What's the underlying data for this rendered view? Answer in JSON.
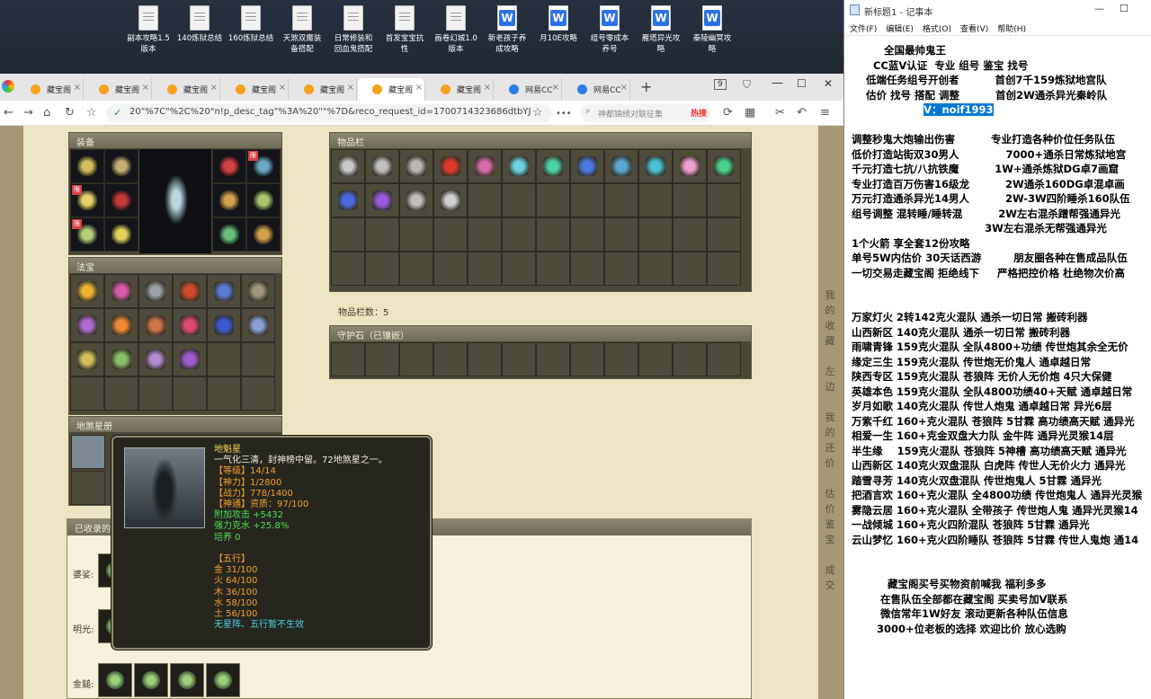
{
  "desktop_icons": [
    {
      "label": "副本攻略1.5\n版本",
      "type": "doc"
    },
    {
      "label": "140炼狱总结",
      "type": "doc"
    },
    {
      "label": "160炼狱总结",
      "type": "doc"
    },
    {
      "label": "天煞双魔装\n备搭配",
      "type": "doc"
    },
    {
      "label": "日常修装和\n回血鬼搭配",
      "type": "doc"
    },
    {
      "label": "首发宝宝抗\n性",
      "type": "doc"
    },
    {
      "label": "画卷幻城1.0\n版本",
      "type": "doc"
    },
    {
      "label": "新老孩子养\n成攻略",
      "type": "wps"
    },
    {
      "label": "月10E攻略",
      "type": "wps"
    },
    {
      "label": "组号零成本\n养号",
      "type": "wps"
    },
    {
      "label": "雁塔异光攻\n略",
      "type": "wps"
    },
    {
      "label": "秦陵幽冥攻\n略",
      "type": "wps"
    }
  ],
  "browser": {
    "tabs": [
      {
        "label": "藏宝阁",
        "fav": "orange"
      },
      {
        "label": "藏宝阁",
        "fav": "orange"
      },
      {
        "label": "藏宝阁",
        "fav": "orange"
      },
      {
        "label": "藏宝阁",
        "fav": "orange"
      },
      {
        "label": "藏宝阁",
        "fav": "orange"
      },
      {
        "label": "藏宝阁",
        "fav": "orange",
        "active": true
      },
      {
        "label": "藏宝阁",
        "fav": "orange"
      },
      {
        "label": "网易CC",
        "fav": "blue"
      },
      {
        "label": "网易CC",
        "fav": "blue"
      }
    ],
    "tab_count": "9",
    "url": "20\"%7C\"%2C%20\"n!p_desc_tag\"%3A%20\"\"%7D&reco_request_id=1700714323686dtbYJ",
    "search_placeholder": "神都锦绣对联征集",
    "search_hot": "热搜"
  },
  "game": {
    "equip_title": "装备",
    "fabao_title": "法宝",
    "inventory_title": "物品栏",
    "inventory_count": "物品栏数：5",
    "guard_title": "守护石（已镶嵌）",
    "dizhao_title": "地煞星册",
    "collected_title": "已收录的",
    "collect_rows": [
      {
        "label": "婆娑:"
      },
      {
        "label": "明光:"
      },
      {
        "label": "金鎚:"
      }
    ],
    "side_nav": [
      "我",
      "的",
      "收",
      "藏",
      "",
      "左",
      "边",
      "",
      "我",
      "的",
      "还",
      "价",
      "",
      "估",
      "价",
      "鉴",
      "宝",
      "",
      "成",
      "交"
    ],
    "equip_badge": "限",
    "colors": {
      "equip": [
        "#d2c05a",
        "#c4b070",
        "#e5d36a",
        "#c43b35",
        "#b3cf7a",
        "#e3d45a",
        "#d24242",
        "#6aa8c4",
        "#d2a44e",
        "#a8c86a",
        "#6ac07a",
        "#d0a04a"
      ],
      "fabao": [
        "#f0b432",
        "#d85aa8",
        "#9aa0a8",
        "#d24a2a",
        "#5a7ad8",
        "#a09878",
        "#b06ad2",
        "#f08a32",
        "#d2744a",
        "#e04a6a",
        "#3a5ad2",
        "#8aa0d2",
        "#d2c05a",
        "#8ac06a",
        "#b48ad2",
        "#a05ad2"
      ],
      "inventory": [
        "#c8c8c8",
        "#c0c0c0",
        "#b8b8b8",
        "#e03a2a",
        "#d86aa8",
        "#6ad2e0",
        "#4ad2a8",
        "#4a7ae0",
        "#5aa8d2",
        "#4ac0d2",
        "#f0a0d0",
        "#4ad28a",
        "#4a6ae0",
        "#9a5ae0",
        "#c0c0c0",
        "#d0d0d0"
      ]
    }
  },
  "tooltip": {
    "name": "地魁星",
    "desc": "一气化三清，封神榜中留。72地煞星之一。",
    "level": "【等级】14/14",
    "shenli": "【神力】1/2800",
    "zhanli": "【战力】778/1400",
    "shentong": "【神通】资质：97/100",
    "attack": "附加攻击 +5432",
    "keshui": "强力克水 +25.8%",
    "peiyang": "培养 0",
    "wuxing_title": "【五行】",
    "wuxing": [
      "金 31/100",
      "火 64/100",
      "木 36/100",
      "水 58/100",
      "土 56/100"
    ],
    "note": "无星阵、五行暂不生效"
  },
  "notepad": {
    "title": "新标题1 - 记事本",
    "menu": [
      "文件(F)",
      "编辑(E)",
      "格式(O)",
      "查看(V)",
      "帮助(H)"
    ],
    "lines": [
      "         全国最帅鬼王",
      "      CC蓝V认证  专业 组号 鉴宝 找号",
      "    低端任务组号开创者          首创7千159炼狱地宫队",
      "    估价 找号 搭配 调整          首创2W通杀异光秦岭队",
      "                    V：noif1993",
      "",
      "调整秒鬼大炮输出伤害          专业打造各种价位任务队伍",
      "低价打造站街双30男人             7000+通杀日常炼狱地宫",
      "千元打造七抗/八抗铁魔          1W+通杀炼狱DG卓7画窟",
      "专业打造百万伤害16级龙          2W通杀160DG卓混卓画",
      "万元打造通杀异光14男人          2W-3W四阶睡杀160队伍",
      "组号调整 混转睡/睡转混          2W左右混杀蹭帮强通异光",
      "                                     3W左右混杀无帮强通异光",
      "1个火箭 享全套12份攻略",
      "单号5W内估价 30天话西游         朋友圈各种在售成品队伍",
      "一切交易走藏宝阁 拒绝线下     严格把控价格 杜绝物次价高",
      "",
      "",
      "万家灯火 2转142克火混队 通杀一切日常 搬砖利器",
      "山西新区 140克火混队 通杀一切日常 搬砖利器",
      "雨啸青锋 159克火混队 全队4800+功绩 传世炮其余全无价",
      "缘定三生 159克火混队 传世炮无价鬼人 通卓越日常",
      "陕西专区 159克火混队 苍狼阵 无价人无价炮 4只大保健",
      "英雄本色 159克火混队 全队4800功绩40+天赋 通卓越日常",
      "岁月如歌 140克火混队 传世人炮鬼 通卓越日常 异光6层",
      "万紫千红 160+克火混队 苍狼阵 5甘霖 高功绩高天赋 通异光",
      "相爱一生 160+克金双盘大力队 金牛阵 通异光灵猴14层",
      "半生缘    159克火混队 苍狼阵 5神槽 高功绩高天赋 通异光",
      "山西新区 140克火双盘混队 白虎阵 传世人无价火力 通异光",
      "踏雪寻芳 140克火双盘混队 传世炮鬼人 5甘霖 通异光",
      "把酒言欢 160+克火混队 全4800功绩 传世炮鬼人 通异光灵猴",
      "雾隐云居 160+克火混队 全带孩子 传世炮人鬼 通异光灵猴14",
      "一战倾城 160+克火四阶混队 苍狼阵 5甘霖 通异光",
      "云山梦忆 160+克火四阶睡队 苍狼阵 5甘霖 传世人鬼炮 通14",
      "",
      "",
      "          藏宝阁买号买物资前喊我 福利多多",
      "        在售队伍全部都在藏宝阁 买卖号加V联系",
      "        微信常年1W好友 滚动更新各种队伍信息",
      "       3000+位老板的选择 欢迎比价 放心选购"
    ],
    "selected_text": "V：noif1993"
  }
}
